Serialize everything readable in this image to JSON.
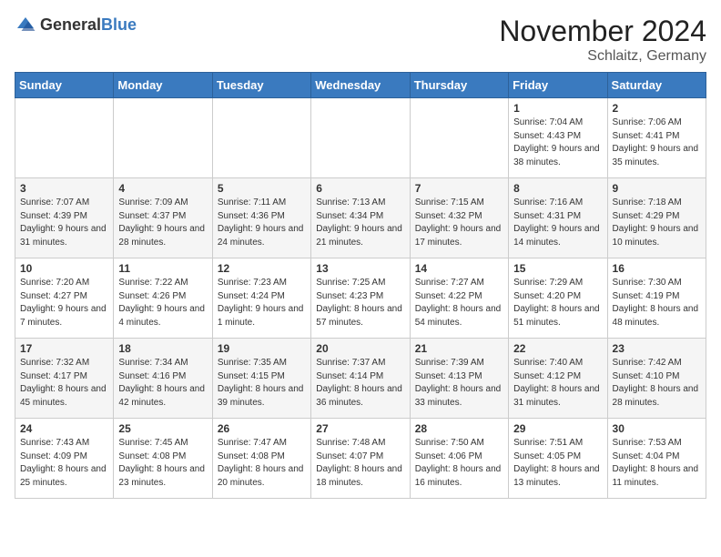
{
  "logo": {
    "general": "General",
    "blue": "Blue"
  },
  "title": "November 2024",
  "location": "Schlaitz, Germany",
  "days_header": [
    "Sunday",
    "Monday",
    "Tuesday",
    "Wednesday",
    "Thursday",
    "Friday",
    "Saturday"
  ],
  "weeks": [
    [
      {
        "day": "",
        "sunrise": "",
        "sunset": "",
        "daylight": ""
      },
      {
        "day": "",
        "sunrise": "",
        "sunset": "",
        "daylight": ""
      },
      {
        "day": "",
        "sunrise": "",
        "sunset": "",
        "daylight": ""
      },
      {
        "day": "",
        "sunrise": "",
        "sunset": "",
        "daylight": ""
      },
      {
        "day": "",
        "sunrise": "",
        "sunset": "",
        "daylight": ""
      },
      {
        "day": "1",
        "sunrise": "Sunrise: 7:04 AM",
        "sunset": "Sunset: 4:43 PM",
        "daylight": "Daylight: 9 hours and 38 minutes."
      },
      {
        "day": "2",
        "sunrise": "Sunrise: 7:06 AM",
        "sunset": "Sunset: 4:41 PM",
        "daylight": "Daylight: 9 hours and 35 minutes."
      }
    ],
    [
      {
        "day": "3",
        "sunrise": "Sunrise: 7:07 AM",
        "sunset": "Sunset: 4:39 PM",
        "daylight": "Daylight: 9 hours and 31 minutes."
      },
      {
        "day": "4",
        "sunrise": "Sunrise: 7:09 AM",
        "sunset": "Sunset: 4:37 PM",
        "daylight": "Daylight: 9 hours and 28 minutes."
      },
      {
        "day": "5",
        "sunrise": "Sunrise: 7:11 AM",
        "sunset": "Sunset: 4:36 PM",
        "daylight": "Daylight: 9 hours and 24 minutes."
      },
      {
        "day": "6",
        "sunrise": "Sunrise: 7:13 AM",
        "sunset": "Sunset: 4:34 PM",
        "daylight": "Daylight: 9 hours and 21 minutes."
      },
      {
        "day": "7",
        "sunrise": "Sunrise: 7:15 AM",
        "sunset": "Sunset: 4:32 PM",
        "daylight": "Daylight: 9 hours and 17 minutes."
      },
      {
        "day": "8",
        "sunrise": "Sunrise: 7:16 AM",
        "sunset": "Sunset: 4:31 PM",
        "daylight": "Daylight: 9 hours and 14 minutes."
      },
      {
        "day": "9",
        "sunrise": "Sunrise: 7:18 AM",
        "sunset": "Sunset: 4:29 PM",
        "daylight": "Daylight: 9 hours and 10 minutes."
      }
    ],
    [
      {
        "day": "10",
        "sunrise": "Sunrise: 7:20 AM",
        "sunset": "Sunset: 4:27 PM",
        "daylight": "Daylight: 9 hours and 7 minutes."
      },
      {
        "day": "11",
        "sunrise": "Sunrise: 7:22 AM",
        "sunset": "Sunset: 4:26 PM",
        "daylight": "Daylight: 9 hours and 4 minutes."
      },
      {
        "day": "12",
        "sunrise": "Sunrise: 7:23 AM",
        "sunset": "Sunset: 4:24 PM",
        "daylight": "Daylight: 9 hours and 1 minute."
      },
      {
        "day": "13",
        "sunrise": "Sunrise: 7:25 AM",
        "sunset": "Sunset: 4:23 PM",
        "daylight": "Daylight: 8 hours and 57 minutes."
      },
      {
        "day": "14",
        "sunrise": "Sunrise: 7:27 AM",
        "sunset": "Sunset: 4:22 PM",
        "daylight": "Daylight: 8 hours and 54 minutes."
      },
      {
        "day": "15",
        "sunrise": "Sunrise: 7:29 AM",
        "sunset": "Sunset: 4:20 PM",
        "daylight": "Daylight: 8 hours and 51 minutes."
      },
      {
        "day": "16",
        "sunrise": "Sunrise: 7:30 AM",
        "sunset": "Sunset: 4:19 PM",
        "daylight": "Daylight: 8 hours and 48 minutes."
      }
    ],
    [
      {
        "day": "17",
        "sunrise": "Sunrise: 7:32 AM",
        "sunset": "Sunset: 4:17 PM",
        "daylight": "Daylight: 8 hours and 45 minutes."
      },
      {
        "day": "18",
        "sunrise": "Sunrise: 7:34 AM",
        "sunset": "Sunset: 4:16 PM",
        "daylight": "Daylight: 8 hours and 42 minutes."
      },
      {
        "day": "19",
        "sunrise": "Sunrise: 7:35 AM",
        "sunset": "Sunset: 4:15 PM",
        "daylight": "Daylight: 8 hours and 39 minutes."
      },
      {
        "day": "20",
        "sunrise": "Sunrise: 7:37 AM",
        "sunset": "Sunset: 4:14 PM",
        "daylight": "Daylight: 8 hours and 36 minutes."
      },
      {
        "day": "21",
        "sunrise": "Sunrise: 7:39 AM",
        "sunset": "Sunset: 4:13 PM",
        "daylight": "Daylight: 8 hours and 33 minutes."
      },
      {
        "day": "22",
        "sunrise": "Sunrise: 7:40 AM",
        "sunset": "Sunset: 4:12 PM",
        "daylight": "Daylight: 8 hours and 31 minutes."
      },
      {
        "day": "23",
        "sunrise": "Sunrise: 7:42 AM",
        "sunset": "Sunset: 4:10 PM",
        "daylight": "Daylight: 8 hours and 28 minutes."
      }
    ],
    [
      {
        "day": "24",
        "sunrise": "Sunrise: 7:43 AM",
        "sunset": "Sunset: 4:09 PM",
        "daylight": "Daylight: 8 hours and 25 minutes."
      },
      {
        "day": "25",
        "sunrise": "Sunrise: 7:45 AM",
        "sunset": "Sunset: 4:08 PM",
        "daylight": "Daylight: 8 hours and 23 minutes."
      },
      {
        "day": "26",
        "sunrise": "Sunrise: 7:47 AM",
        "sunset": "Sunset: 4:08 PM",
        "daylight": "Daylight: 8 hours and 20 minutes."
      },
      {
        "day": "27",
        "sunrise": "Sunrise: 7:48 AM",
        "sunset": "Sunset: 4:07 PM",
        "daylight": "Daylight: 8 hours and 18 minutes."
      },
      {
        "day": "28",
        "sunrise": "Sunrise: 7:50 AM",
        "sunset": "Sunset: 4:06 PM",
        "daylight": "Daylight: 8 hours and 16 minutes."
      },
      {
        "day": "29",
        "sunrise": "Sunrise: 7:51 AM",
        "sunset": "Sunset: 4:05 PM",
        "daylight": "Daylight: 8 hours and 13 minutes."
      },
      {
        "day": "30",
        "sunrise": "Sunrise: 7:53 AM",
        "sunset": "Sunset: 4:04 PM",
        "daylight": "Daylight: 8 hours and 11 minutes."
      }
    ]
  ]
}
